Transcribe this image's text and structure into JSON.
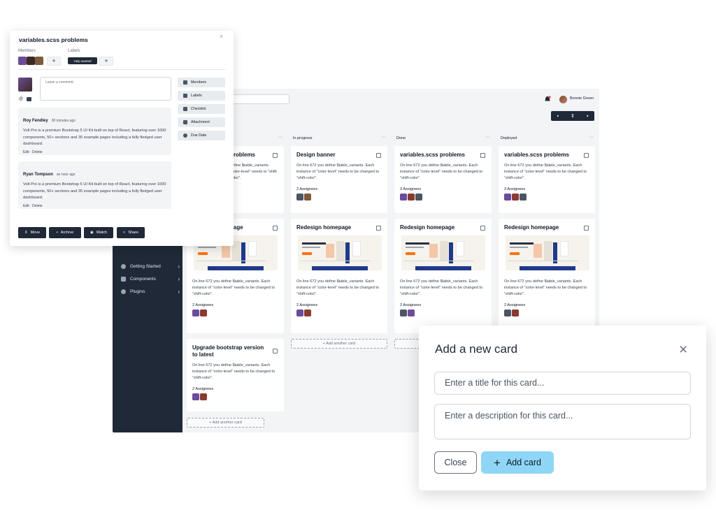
{
  "colors": {
    "sidebar": "#1f2937",
    "accent": "#8fd6f6",
    "board_bg": "#f2f4f6",
    "dark_button": "#1f2937",
    "help_badge": "#1f2937"
  },
  "app": {
    "user_name": "Bonnie Green",
    "toolbar_icons": [
      "archive-icon",
      "sort-icon",
      "trash-icon"
    ],
    "sidebar": {
      "items": [
        {
          "label": "Getting Started",
          "icon": "info-icon"
        },
        {
          "label": "Components",
          "icon": "archive-icon"
        },
        {
          "label": "Plugins",
          "icon": "puzzle-icon"
        }
      ]
    },
    "columns": [
      {
        "title": "",
        "menu": "···",
        "cards": [
          {
            "title": "problems",
            "text": "define $table_variants. \"color-level\" needs to \"shift-color\".",
            "assignees": ""
          },
          {
            "title": "page",
            "text": "On line 672 you define $table_variants. Each instance of \"color-level\" needs to be changed to \"shift-color\".",
            "assignees": "2 Assignees"
          },
          {
            "title": "Upgrade bootstrap version to latest",
            "text": "On line 672 you define $table_variants. Each instance of \"color-level\" needs to be changed to \"shift-color\".",
            "assignees": "2 Assignees"
          }
        ],
        "add": "+  Add another card"
      },
      {
        "title": "In progress",
        "menu": "···",
        "cards": [
          {
            "title": "Design banner",
            "text": "On line 672 you define $table_variants. Each instance of \"color-level\" needs to be changed to \"shift-color\".",
            "assignees": "2 Assignees"
          },
          {
            "title": "Redesign homepage",
            "text": "On line 672 you define $table_variants. Each instance of \"color-level\" needs to be changed to \"shift-color\".",
            "assignees": "2 Assignees"
          }
        ],
        "add": "+  Add another card"
      },
      {
        "title": "Done",
        "menu": "···",
        "cards": [
          {
            "title": "variables.scss problems",
            "text": "On line 672 you define $table_variants. Each instance of \"color-level\" needs to be changed to \"shift-color\".",
            "assignees": "3 Assignees"
          },
          {
            "title": "Redesign homepage",
            "text": "On line 672 you define $table_variants. Each instance of \"color-level\" needs to be changed to \"shift-color\".",
            "assignees": "2 Assignees"
          }
        ]
      },
      {
        "title": "Deployed",
        "menu": "···",
        "cards": [
          {
            "title": "variables.scss problems",
            "text": "On line 672 you define $table_variants. Each instance of \"color-level\" needs to be changed to \"shift-color\".",
            "assignees": "3 Assignees"
          },
          {
            "title": "Redesign homepage",
            "text": "On line 672 you define $table_variants. Each instance of \"color-level\" needs to be changed to \"shift-color\".",
            "assignees": "2 Assignees"
          }
        ]
      }
    ]
  },
  "detail": {
    "title": "variables.scss problems",
    "close": "×",
    "members_label": "Members",
    "labels_label": "Labels",
    "label_badge": "Help wanted",
    "add": "+",
    "comment_placeholder": "Leave a comment",
    "actions": [
      "Members",
      "Labels",
      "Checklist",
      "Attachment",
      "Due Date"
    ],
    "comments": [
      {
        "author": "Roy Fendley",
        "time": "30 minutes ago",
        "text": "Volt Pro is a premium Bootstrap 5 UI Kit built on top of React, featuring over 1000 components, 50+ sections and 35 example pages including a fully fledged user dashboard.",
        "edit": "Edit · Delete"
      },
      {
        "author": "Ryan Tompson",
        "time": "an hour ago",
        "text": "Volt Pro is a premium Bootstrap 5 UI Kit built on top of React, featuring over 1000 components, 50+ sections and 35 example pages including a fully fledged user dashboard.",
        "edit": "Edit · Delete"
      }
    ],
    "buttons": [
      "Move",
      "Archive",
      "Watch",
      "Share"
    ]
  },
  "modal": {
    "title": "Add a new card",
    "close": "×",
    "title_placeholder": "Enter a title for this card...",
    "desc_placeholder": "Enter a description for this card...",
    "close_button": "Close",
    "add_button": "Add card",
    "add_icon": "+"
  }
}
